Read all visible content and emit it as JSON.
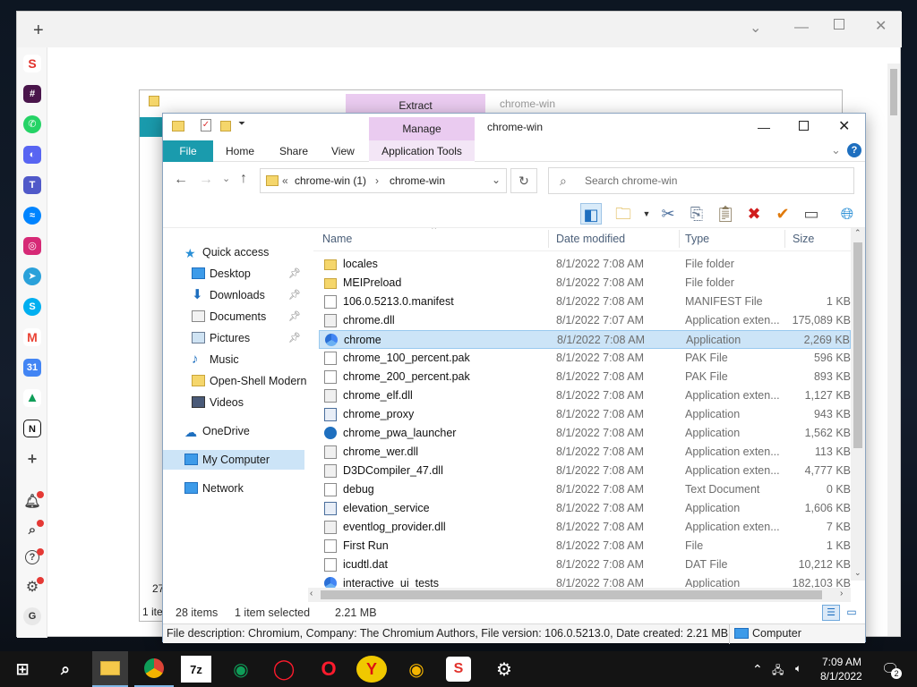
{
  "browser": {
    "new_tab_symbol": "+"
  },
  "back_window": {
    "ribbon_tab": "Extract",
    "title": "chrome-win",
    "status_left": "1 ite",
    "status_count_partial": "27"
  },
  "explorer": {
    "title": "chrome-win",
    "context_tab": "Manage",
    "ribbon_tabs": [
      "File",
      "Home",
      "Share",
      "View",
      "Application Tools"
    ],
    "address": {
      "prefix": "«",
      "parts": [
        "chrome-win (1)",
        "chrome-win"
      ]
    },
    "search_placeholder": "Search chrome-win",
    "columns": {
      "name": "Name",
      "date": "Date modified",
      "type": "Type",
      "size": "Size"
    },
    "nav": {
      "quick_access": "Quick access",
      "items": [
        "Desktop",
        "Downloads",
        "Documents",
        "Pictures",
        "Music",
        "Open-Shell Modern",
        "Videos"
      ],
      "onedrive": "OneDrive",
      "computer": "My Computer",
      "network": "Network"
    },
    "files": [
      {
        "name": "locales",
        "date": "8/1/2022 7:08 AM",
        "type": "File folder",
        "size": "",
        "icon": "folder"
      },
      {
        "name": "MEIPreload",
        "date": "8/1/2022 7:08 AM",
        "type": "File folder",
        "size": "",
        "icon": "folder"
      },
      {
        "name": "106.0.5213.0.manifest",
        "date": "8/1/2022 7:08 AM",
        "type": "MANIFEST File",
        "size": "1 KB",
        "icon": "file"
      },
      {
        "name": "chrome.dll",
        "date": "8/1/2022 7:07 AM",
        "type": "Application exten...",
        "size": "175,089 KB",
        "icon": "dll"
      },
      {
        "name": "chrome",
        "date": "8/1/2022 7:08 AM",
        "type": "Application",
        "size": "2,269 KB",
        "icon": "chrome",
        "selected": true
      },
      {
        "name": "chrome_100_percent.pak",
        "date": "8/1/2022 7:08 AM",
        "type": "PAK File",
        "size": "596 KB",
        "icon": "file"
      },
      {
        "name": "chrome_200_percent.pak",
        "date": "8/1/2022 7:08 AM",
        "type": "PAK File",
        "size": "893 KB",
        "icon": "file"
      },
      {
        "name": "chrome_elf.dll",
        "date": "8/1/2022 7:08 AM",
        "type": "Application exten...",
        "size": "1,127 KB",
        "icon": "dll"
      },
      {
        "name": "chrome_proxy",
        "date": "8/1/2022 7:08 AM",
        "type": "Application",
        "size": "943 KB",
        "icon": "app"
      },
      {
        "name": "chrome_pwa_launcher",
        "date": "8/1/2022 7:08 AM",
        "type": "Application",
        "size": "1,562 KB",
        "icon": "pwa"
      },
      {
        "name": "chrome_wer.dll",
        "date": "8/1/2022 7:08 AM",
        "type": "Application exten...",
        "size": "113 KB",
        "icon": "dll"
      },
      {
        "name": "D3DCompiler_47.dll",
        "date": "8/1/2022 7:08 AM",
        "type": "Application exten...",
        "size": "4,777 KB",
        "icon": "dll"
      },
      {
        "name": "debug",
        "date": "8/1/2022 7:08 AM",
        "type": "Text Document",
        "size": "0 KB",
        "icon": "txt"
      },
      {
        "name": "elevation_service",
        "date": "8/1/2022 7:08 AM",
        "type": "Application",
        "size": "1,606 KB",
        "icon": "app"
      },
      {
        "name": "eventlog_provider.dll",
        "date": "8/1/2022 7:08 AM",
        "type": "Application exten...",
        "size": "7 KB",
        "icon": "dll"
      },
      {
        "name": "First Run",
        "date": "8/1/2022 7:08 AM",
        "type": "File",
        "size": "1 KB",
        "icon": "file"
      },
      {
        "name": "icudtl.dat",
        "date": "8/1/2022 7:08 AM",
        "type": "DAT File",
        "size": "10,212 KB",
        "icon": "file"
      },
      {
        "name": "interactive_ui_tests",
        "date": "8/1/2022 7:08 AM",
        "type": "Application",
        "size": "182,103 KB",
        "icon": "chrome"
      }
    ],
    "status": {
      "count": "28 items",
      "selected": "1 item selected",
      "size": "2.21 MB"
    },
    "description": "File description: Chromium, Company: The Chromium Authors, File version: 106.0.5213.0, Date created: 2.21 MB",
    "description_right": "Computer"
  },
  "taskbar": {
    "icons": [
      "windows-start",
      "search",
      "file-explorer",
      "chrome",
      "7zip",
      "edge",
      "opera",
      "opera-gx",
      "yandex",
      "chrome-canary",
      "shift",
      "settings"
    ],
    "sevenzip_label": "7z",
    "time": "7:09 AM",
    "date": "8/1/2022",
    "notification_count": "2"
  },
  "colors": {
    "accent": "#1a9bad",
    "selection": "#cce4f7",
    "context_tab": "#eacbf0"
  }
}
